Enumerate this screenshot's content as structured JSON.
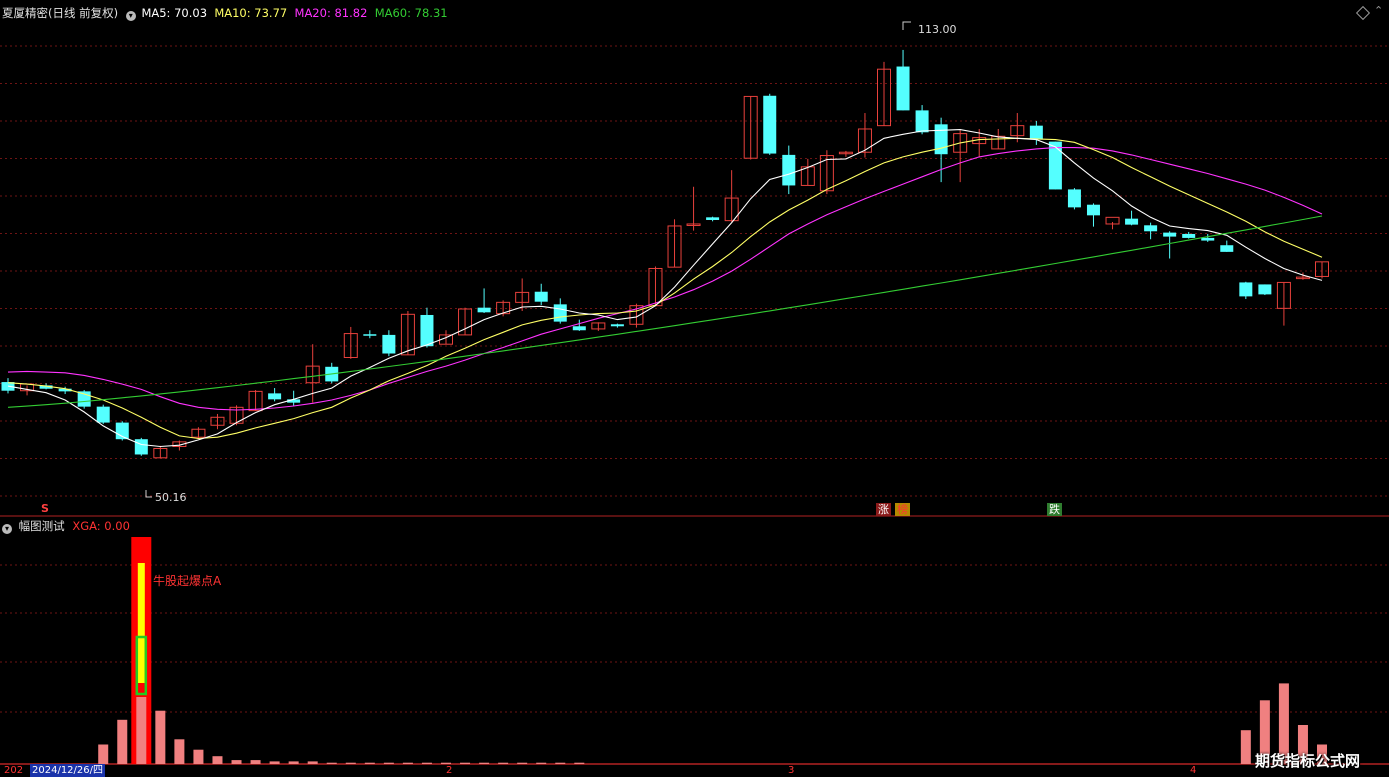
{
  "header": {
    "title": "夏厦精密(日线 前复权)",
    "ma5": "MA5: 70.03",
    "ma10": "MA10: 73.77",
    "ma20": "MA20: 81.82",
    "ma60": "MA60: 78.31"
  },
  "annotations": {
    "high": "113.00",
    "low": "50.16",
    "signal_s": "S",
    "zhang": "涨",
    "bang": "榜",
    "die": "跌"
  },
  "indicator": {
    "title": "幅图测试",
    "xga": "XGA: 0.00",
    "signal_label": "牛股起爆点A"
  },
  "footer": {
    "date": "2024/12/26/四",
    "left_stub": "202",
    "tick_2": "2",
    "tick_3": "3",
    "tick_4": "4"
  },
  "watermark": "期货指标公式网",
  "colors": {
    "up": "#e8413c",
    "down": "#54ffff",
    "ma5": "#ffffff",
    "ma10": "#ffff66",
    "ma20": "#ff33ff",
    "ma60": "#33cc33",
    "grid": "#6e1414",
    "sep": "#b22222",
    "vol_bar": "#f08080",
    "signal_bg": "#ff0000"
  },
  "chart_data": [
    {
      "type": "candlestick",
      "title": "夏厦精密(日线 前复权)",
      "ylim": [
        46,
        116
      ],
      "series": [
        {
          "name": "MA5",
          "color": "#ffffff"
        },
        {
          "name": "MA10",
          "color": "#ffff66"
        },
        {
          "name": "MA20",
          "color": "#ff33ff"
        },
        {
          "name": "MA60",
          "color": "#33cc33"
        }
      ],
      "candles_ohlc": [
        [
          63.0,
          63.6,
          61.3,
          61.7
        ],
        [
          61.7,
          62.5,
          61.0,
          62.7
        ],
        [
          62.5,
          62.8,
          61.9,
          62.0
        ],
        [
          62.0,
          62.3,
          61.2,
          61.6
        ],
        [
          61.6,
          61.8,
          59.0,
          59.3
        ],
        [
          59.3,
          59.6,
          56.7,
          56.9
        ],
        [
          56.9,
          57.1,
          54.2,
          54.4
        ],
        [
          54.4,
          54.6,
          51.9,
          52.1
        ],
        [
          51.6,
          53.4,
          51.6,
          53.0
        ],
        [
          53.3,
          54.2,
          52.7,
          54.0
        ],
        [
          54.7,
          56.2,
          54.4,
          55.9
        ],
        [
          56.5,
          58.2,
          55.9,
          57.7
        ],
        [
          56.8,
          59.5,
          56.5,
          59.2
        ],
        [
          58.7,
          61.8,
          58.7,
          61.6
        ],
        [
          61.3,
          62.1,
          60.1,
          60.4
        ],
        [
          60.4,
          61.7,
          59.4,
          59.9
        ],
        [
          62.9,
          68.7,
          59.9,
          65.4
        ],
        [
          65.3,
          65.9,
          62.8,
          63.1
        ],
        [
          66.7,
          71.3,
          66.5,
          70.3
        ],
        [
          70.2,
          70.8,
          69.6,
          70.0
        ],
        [
          70.1,
          70.8,
          66.9,
          67.3
        ],
        [
          67.1,
          73.7,
          67.1,
          73.2
        ],
        [
          73.1,
          74.2,
          68.2,
          68.4
        ],
        [
          68.7,
          70.8,
          68.7,
          70.1
        ],
        [
          70.1,
          74.2,
          70.1,
          74.0
        ],
        [
          74.2,
          77.1,
          73.4,
          73.5
        ],
        [
          73.3,
          75.3,
          72.9,
          75.0
        ],
        [
          75.0,
          78.6,
          73.7,
          76.5
        ],
        [
          76.6,
          77.8,
          74.6,
          75.1
        ],
        [
          74.7,
          75.6,
          71.8,
          72.1
        ],
        [
          71.4,
          72.4,
          70.7,
          70.8
        ],
        [
          71.0,
          72.0,
          70.7,
          71.9
        ],
        [
          71.7,
          71.8,
          71.2,
          71.4
        ],
        [
          71.7,
          74.8,
          71.2,
          74.5
        ],
        [
          74.5,
          80.4,
          74.5,
          80.1
        ],
        [
          80.3,
          87.5,
          80.3,
          86.5
        ],
        [
          86.6,
          92.4,
          85.8,
          86.8
        ],
        [
          87.8,
          87.9,
          87.2,
          87.4
        ],
        [
          87.3,
          94.9,
          87.1,
          90.7
        ],
        [
          96.7,
          106.0,
          96.5,
          106.0
        ],
        [
          106.1,
          106.4,
          97.2,
          97.4
        ],
        [
          97.2,
          98.6,
          91.3,
          92.6
        ],
        [
          92.6,
          96.6,
          92.6,
          95.4
        ],
        [
          91.8,
          97.9,
          91.3,
          97.1
        ],
        [
          97.5,
          97.8,
          96.9,
          97.6
        ],
        [
          97.6,
          103.5,
          96.8,
          101.1
        ],
        [
          101.6,
          111.2,
          101.6,
          110.1
        ],
        [
          110.5,
          113.0,
          103.9,
          103.9
        ],
        [
          103.9,
          104.7,
          100.3,
          100.6
        ],
        [
          101.8,
          102.8,
          93.1,
          97.3
        ],
        [
          97.6,
          101.1,
          93.1,
          100.4
        ],
        [
          98.9,
          101.1,
          96.9,
          99.8
        ],
        [
          98.1,
          101.1,
          98.1,
          100.0
        ],
        [
          100.1,
          103.5,
          99.1,
          101.6
        ],
        [
          101.6,
          102.3,
          98.7,
          99.5
        ],
        [
          99.2,
          99.2,
          92.0,
          92.0
        ],
        [
          92.0,
          92.2,
          89.0,
          89.3
        ],
        [
          89.7,
          89.9,
          86.4,
          88.1
        ],
        [
          86.8,
          87.1,
          86.0,
          87.8
        ],
        [
          87.6,
          88.8,
          86.6,
          86.7
        ],
        [
          86.6,
          87.0,
          84.5,
          85.7
        ],
        [
          85.5,
          85.7,
          81.6,
          84.9
        ],
        [
          85.3,
          85.6,
          84.6,
          84.7
        ],
        [
          84.7,
          85.3,
          84.1,
          84.3
        ],
        [
          83.6,
          84.3,
          82.6,
          82.6
        ],
        [
          78.0,
          78.1,
          75.5,
          75.9
        ],
        [
          77.7,
          77.7,
          76.1,
          76.2
        ],
        [
          74.1,
          78.0,
          71.5,
          78.0
        ],
        [
          78.8,
          79.5,
          78.4,
          78.8
        ],
        [
          78.9,
          81.1,
          78.6,
          81.1
        ]
      ],
      "ma5": [
        62.4,
        61.9,
        61.4,
        60.3,
        58.5,
        56.4,
        54.8,
        53.6,
        53.3,
        53.5,
        54.3,
        55.2,
        56.9,
        58.4,
        59.6,
        60.4,
        61.3,
        62.1,
        63.9,
        65.2,
        66.6,
        67.7,
        68.6,
        69.7,
        71.0,
        72.4,
        73.4,
        74.3,
        74.4,
        74.0,
        73.4,
        73.1,
        72.4,
        72.8,
        74.5,
        77.3,
        80.6,
        83.8,
        87.0,
        90.6,
        93.5,
        94.3,
        95.3,
        96.5,
        96.6,
        97.9,
        99.7,
        100.3,
        100.8,
        100.9,
        101.0,
        100.5,
        99.9,
        99.7,
        99.5,
        98.4,
        96.0,
        93.7,
        91.8,
        89.5,
        87.8,
        86.5,
        86.1,
        85.8,
        85.1,
        83.3,
        81.6,
        80.1,
        79.1,
        78.3
      ],
      "ma10": [
        62.9,
        62.7,
        62.4,
        62.0,
        61.2,
        60.3,
        59.1,
        57.7,
        56.2,
        54.9,
        54.5,
        54.7,
        55.3,
        56.1,
        56.8,
        57.5,
        58.4,
        59.2,
        60.6,
        61.8,
        63.2,
        64.3,
        65.5,
        66.9,
        68.1,
        69.4,
        70.5,
        71.6,
        72.3,
        72.8,
        73.1,
        73.3,
        73.4,
        73.7,
        74.6,
        76.4,
        78.5,
        80.4,
        82.5,
        84.9,
        87.1,
        88.9,
        90.4,
        92.0,
        93.3,
        94.7,
        96.0,
        96.9,
        97.6,
        98.2,
        99.0,
        99.5,
        99.6,
        99.7,
        99.6,
        99.5,
        99.1,
        98.0,
        96.8,
        95.3,
        93.9,
        92.5,
        91.2,
        89.9,
        88.6,
        87.2,
        85.6,
        84.2,
        83.0,
        81.8
      ],
      "ma20": [
        64.5,
        64.6,
        64.5,
        64.4,
        64.0,
        63.4,
        62.7,
        61.9,
        60.8,
        59.8,
        59.2,
        58.9,
        58.8,
        58.9,
        59.1,
        59.4,
        59.8,
        60.3,
        61.0,
        61.8,
        62.8,
        63.7,
        64.6,
        65.4,
        66.3,
        67.3,
        68.2,
        69.2,
        70.2,
        71.0,
        71.8,
        72.6,
        73.3,
        74.0,
        74.9,
        75.8,
        76.9,
        78.2,
        79.7,
        81.5,
        83.4,
        85.3,
        86.8,
        88.2,
        89.4,
        90.6,
        91.7,
        92.8,
        93.9,
        95.0,
        96.0,
        96.9,
        97.4,
        97.8,
        98.1,
        98.3,
        98.3,
        98.2,
        97.8,
        97.2,
        96.5,
        95.8,
        95.1,
        94.4,
        93.6,
        92.8,
        91.9,
        90.8,
        89.6,
        88.3
      ]
    },
    {
      "type": "bar",
      "title": "幅图测试",
      "series": [
        {
          "name": "XGA",
          "values": []
        }
      ],
      "volume_heights": [
        0,
        0,
        0,
        0,
        0,
        15,
        34,
        56,
        41,
        19,
        11,
        6,
        3,
        3,
        2,
        2,
        2,
        1,
        1,
        1,
        1,
        1,
        1,
        1,
        1,
        1,
        1,
        1,
        1,
        1,
        1,
        0,
        0,
        0,
        0,
        0,
        0,
        0,
        0,
        0,
        0,
        0,
        0,
        0,
        0,
        0,
        0,
        0,
        0,
        0,
        0,
        0,
        0,
        0,
        0,
        0,
        0,
        0,
        0,
        0,
        0,
        0,
        0,
        0,
        0,
        26,
        49,
        62,
        30,
        15
      ]
    }
  ]
}
